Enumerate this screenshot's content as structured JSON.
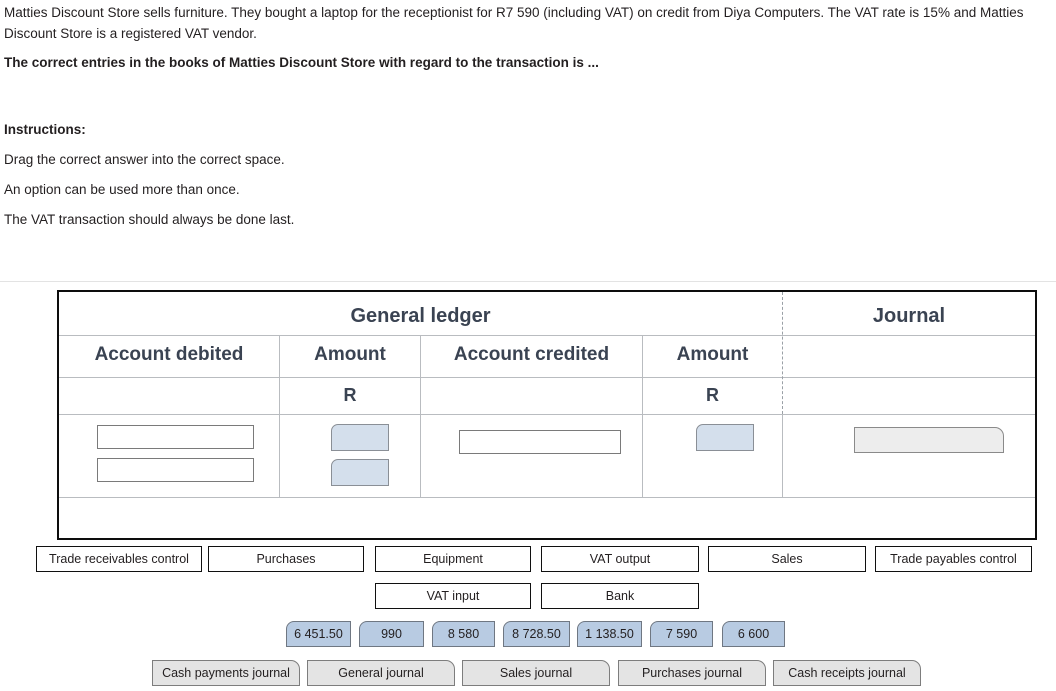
{
  "question": {
    "scenario": "Matties Discount Store sells furniture. They bought a laptop for the receptionist for R7 590 (including VAT) on credit from Diya Computers. The VAT rate is 15% and Matties Discount Store is a registered VAT vendor.",
    "prompt": "The correct entries in the books of Matties Discount Store with regard to the transaction is ...",
    "instructions_title": "Instructions:",
    "instruction_1": "Drag the correct answer into the correct space.",
    "instruction_2": "An option can be used more than once.",
    "instruction_3": "The VAT transaction should always be done last."
  },
  "table": {
    "group_general_ledger": "General ledger",
    "group_journal": "Journal",
    "col_account_debited": "Account debited",
    "col_amount_debit": "Amount",
    "col_account_credited": "Account credited",
    "col_amount_credit": "Amount",
    "currency_debit": "R",
    "currency_credit": "R"
  },
  "options": {
    "accounts_row1": [
      "Trade receivables control",
      "Purchases",
      "Equipment",
      "VAT output",
      "Sales",
      "Trade payables control"
    ],
    "accounts_row2": [
      "VAT input",
      "Bank"
    ],
    "amounts": [
      "6 451.50",
      "990",
      "8 580",
      "8 728.50",
      "1 138.50",
      "7 590",
      "6 600"
    ],
    "journals": [
      "Cash payments journal",
      "General journal",
      "Sales journal",
      "Purchases journal",
      "Cash receipts journal"
    ]
  },
  "answers": {
    "account_debited_1": "",
    "account_debited_2": "",
    "amount_debit_1": "",
    "amount_debit_2": "",
    "account_credited_1": "",
    "amount_credit_1": "",
    "journal_1": ""
  },
  "colors": {
    "amount_chip": "#b8cbe2",
    "journal_chip": "#e4e4e4",
    "header_text": "#3a4352",
    "table_border": "#0d0d0d"
  }
}
